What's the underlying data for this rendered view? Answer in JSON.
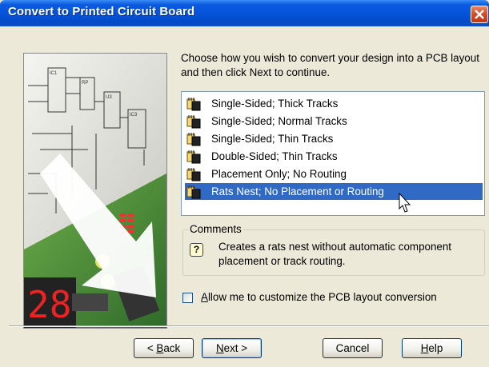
{
  "window": {
    "title": "Convert to Printed Circuit Board"
  },
  "instruction": "Choose how you wish to convert your design into a PCB layout and then click Next to continue.",
  "list": {
    "items": [
      {
        "label": "Single-Sided; Thick Tracks",
        "selected": false
      },
      {
        "label": "Single-Sided; Normal Tracks",
        "selected": false
      },
      {
        "label": "Single-Sided; Thin Tracks",
        "selected": false
      },
      {
        "label": "Double-Sided; Thin Tracks",
        "selected": false
      },
      {
        "label": "Placement Only; No Routing",
        "selected": false
      },
      {
        "label": "Rats Nest; No Placement or Routing",
        "selected": true
      }
    ]
  },
  "comments": {
    "legend": "Comments",
    "text": "Creates a rats nest without automatic component placement or track routing."
  },
  "option": {
    "label_pre": "",
    "label_u": "A",
    "label_post": "llow me to customize the PCB layout conversion",
    "checked": false
  },
  "buttons": {
    "back": {
      "pre": "< ",
      "u": "B",
      "post": "ack"
    },
    "next": {
      "pre": "",
      "u": "N",
      "post": "ext >"
    },
    "cancel": "Cancel",
    "help": {
      "pre": "",
      "u": "H",
      "post": "elp"
    }
  },
  "colors": {
    "titlebar": "#0553d8",
    "selection": "#316ac5",
    "dialog": "#ece9d8"
  }
}
